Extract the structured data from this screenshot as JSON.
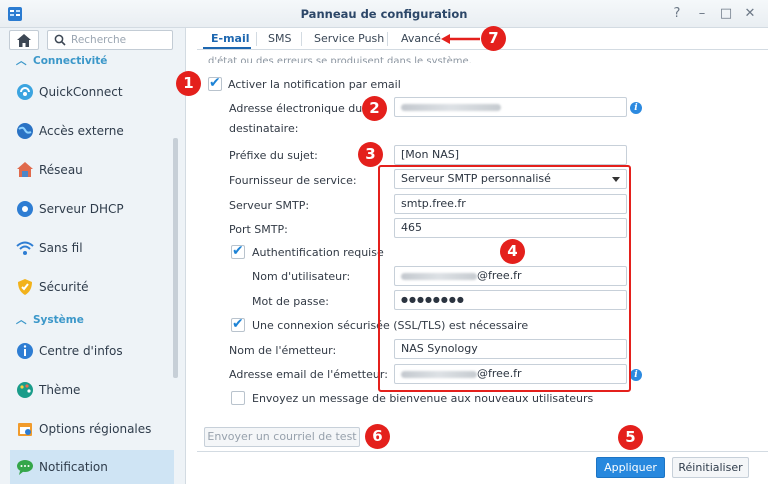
{
  "window": {
    "title": "Panneau de configuration",
    "help_glyph": "?",
    "minimize_glyph": "–",
    "maximize_glyph": "□",
    "close_glyph": "✕"
  },
  "sidebar": {
    "search_placeholder": "Recherche",
    "sections": [
      {
        "label": "Connectivité"
      },
      {
        "label": "Système"
      }
    ],
    "items": [
      {
        "label": "QuickConnect"
      },
      {
        "label": "Accès externe"
      },
      {
        "label": "Réseau"
      },
      {
        "label": "Serveur DHCP"
      },
      {
        "label": "Sans fil"
      },
      {
        "label": "Sécurité"
      },
      {
        "label": "Centre d'infos"
      },
      {
        "label": "Thème"
      },
      {
        "label": "Options régionales"
      },
      {
        "label": "Notification"
      }
    ]
  },
  "tabs": [
    {
      "label": "E-mail"
    },
    {
      "label": "SMS"
    },
    {
      "label": "Service Push"
    },
    {
      "label": "Avancé"
    }
  ],
  "cut_text": "d'état ou des erreurs se produisent dans le système.",
  "form": {
    "enable_label": "Activer la notification par email",
    "recipient_label_1": "Adresse électronique du",
    "recipient_label_2": "destinataire:",
    "subject_label": "Préfixe du sujet:",
    "subject_value": "[Mon NAS]",
    "provider_label": "Fournisseur de service:",
    "provider_value": "Serveur SMTP personnalisé",
    "smtp_label": "Serveur SMTP:",
    "smtp_value": "smtp.free.fr",
    "port_label": "Port SMTP:",
    "port_value": "465",
    "auth_label": "Authentification requise",
    "username_label": "Nom d'utilisateur:",
    "username_suffix": "@free.fr",
    "password_label": "Mot de passe:",
    "password_value": "●●●●●●●●",
    "ssl_label": "Une connexion sécurisée (SSL/TLS) est nécessaire",
    "sender_name_label": "Nom de l'émetteur:",
    "sender_name_value": "NAS Synology",
    "sender_email_label": "Adresse email de l'émetteur:",
    "sender_email_suffix": "@free.fr",
    "welcome_label": "Envoyez un message de bienvenue aux nouveaux utilisateurs",
    "test_button": "Envoyer un courriel de test",
    "info_glyph": "i"
  },
  "footer": {
    "apply": "Appliquer",
    "reset": "Réinitialiser"
  },
  "annotations": {
    "b1": "1",
    "b2": "2",
    "b3": "3",
    "b4": "4",
    "b5": "5",
    "b6": "6",
    "b7": "7"
  },
  "colors": {
    "accent": "#2788de",
    "annotation_red": "#e4201c",
    "active_nav": "#cfe4f4"
  },
  "icons": [
    "home-icon",
    "search-icon",
    "quickconnect-icon",
    "globe-icon",
    "network-icon",
    "dhcp-icon",
    "wifi-icon",
    "shield-icon",
    "info-icon",
    "palette-icon",
    "calendar-icon",
    "chat-icon"
  ]
}
